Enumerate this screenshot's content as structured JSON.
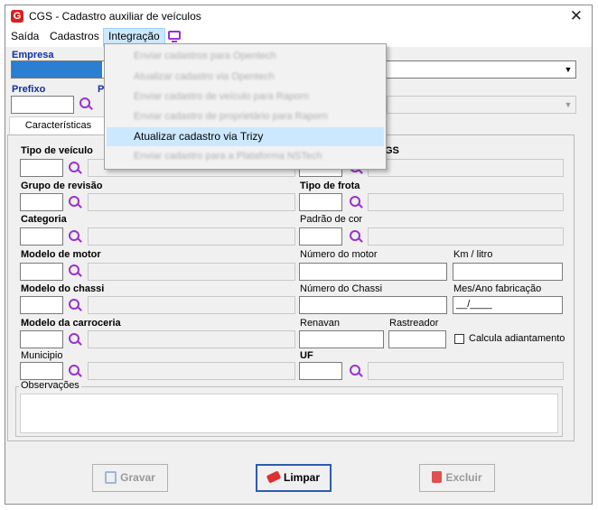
{
  "window": {
    "title": "CGS - Cadastro auxiliar de veículos"
  },
  "menu": {
    "items": [
      "Saída",
      "Cadastros",
      "Integração"
    ]
  },
  "dropdown": {
    "items": [
      "Enviar cadastros para Opentech",
      "Atualizar cadastro via Opentech",
      "Enviar cadastro de veículo para Raporn",
      "Enviar cadastro de proprietário para Raporn",
      "Atualizar cadastro via Trizy",
      "Enviar cadastro para a Plataforma NSTech"
    ]
  },
  "header": {
    "empresa_label": "Empresa",
    "prefixo_label": "Prefixo",
    "placa_label": "P"
  },
  "tab": {
    "label": "Características"
  },
  "fields": {
    "tipo_veiculo": "Tipo de veículo",
    "cgs_partial": "GS",
    "grupo_revisao": "Grupo de revisão",
    "tipo_frota": "Tipo de frota",
    "categoria": "Categoria",
    "padrao_cor": "Padrão de cor",
    "modelo_motor": "Modelo de motor",
    "numero_motor": "Número do motor",
    "km_litro": "Km / litro",
    "modelo_chassi": "Modelo do chassi",
    "numero_chassi": "Número do Chassi",
    "mes_ano": "Mes/Ano fabricação",
    "mes_ano_value": "__/____",
    "modelo_carroceria": "Modelo da carroceria",
    "renavan": "Renavan",
    "rastreador": "Rastreador",
    "calcula": "Calcula adiantamento",
    "municipio": "Municipio",
    "uf": "UF",
    "observacoes": "Observações"
  },
  "buttons": {
    "gravar": "Gravar",
    "limpar": "Limpar",
    "excluir": "Excluir"
  }
}
